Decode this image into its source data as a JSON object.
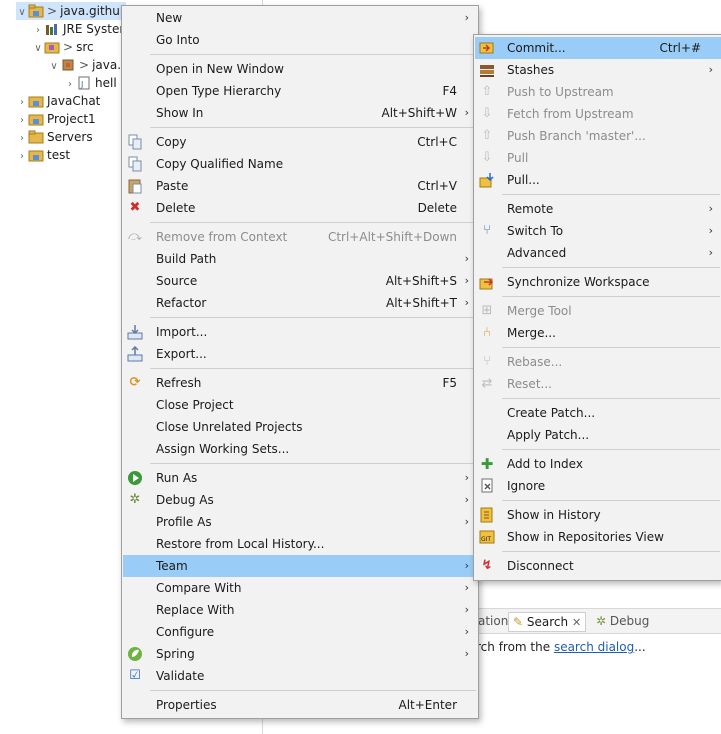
{
  "explorer": {
    "rows": [
      {
        "label": "java.githubr",
        "prefix": ">",
        "twist": "∨"
      },
      {
        "label": "JRE System",
        "twist": "›"
      },
      {
        "label": "src",
        "prefix": ">",
        "twist": "∨"
      },
      {
        "label": "java.",
        "prefix": ">",
        "twist": "∨"
      },
      {
        "label": "hell",
        "twist": "›"
      },
      {
        "label": "JavaChat",
        "twist": "›"
      },
      {
        "label": "Project1",
        "twist": "›"
      },
      {
        "label": "Servers",
        "twist": "›"
      },
      {
        "label": "test",
        "twist": "›"
      }
    ]
  },
  "bottom": {
    "tab_partial": "ation",
    "search_tab": "Search",
    "debug_tab": "Debug",
    "text_prefix": "rch from the ",
    "link": "search dialog",
    "text_suffix": "..."
  },
  "context_menu": {
    "items": [
      {
        "label": "New",
        "submenu": true
      },
      {
        "label": "Go Into"
      },
      {
        "label": "Open in New Window"
      },
      {
        "label": "Open Type Hierarchy",
        "accel": "F4"
      },
      {
        "label": "Show In",
        "accel": "Alt+Shift+W",
        "submenu": true
      },
      {
        "label": "Copy",
        "accel": "Ctrl+C",
        "icon": "copy-icon"
      },
      {
        "label": "Copy Qualified Name",
        "icon": "copy-qualified-icon"
      },
      {
        "label": "Paste",
        "accel": "Ctrl+V",
        "icon": "paste-icon"
      },
      {
        "label": "Delete",
        "accel": "Delete",
        "icon": "delete-icon"
      },
      {
        "label": "Remove from Context",
        "accel": "Ctrl+Alt+Shift+Down",
        "disabled": true,
        "icon": "remove-context-icon"
      },
      {
        "label": "Build Path",
        "submenu": true
      },
      {
        "label": "Source",
        "accel": "Alt+Shift+S",
        "submenu": true
      },
      {
        "label": "Refactor",
        "accel": "Alt+Shift+T",
        "submenu": true
      },
      {
        "label": "Import...",
        "icon": "import-icon"
      },
      {
        "label": "Export...",
        "icon": "export-icon"
      },
      {
        "label": "Refresh",
        "accel": "F5",
        "icon": "refresh-icon"
      },
      {
        "label": "Close Project"
      },
      {
        "label": "Close Unrelated Projects"
      },
      {
        "label": "Assign Working Sets..."
      },
      {
        "label": "Run As",
        "submenu": true,
        "icon": "run-icon"
      },
      {
        "label": "Debug As",
        "submenu": true,
        "icon": "debug-icon"
      },
      {
        "label": "Profile As",
        "submenu": true
      },
      {
        "label": "Restore from Local History..."
      },
      {
        "label": "Team",
        "submenu": true,
        "highlighted": true
      },
      {
        "label": "Compare With",
        "submenu": true
      },
      {
        "label": "Replace With",
        "submenu": true
      },
      {
        "label": "Configure",
        "submenu": true
      },
      {
        "label": "Spring",
        "submenu": true,
        "icon": "spring-icon"
      },
      {
        "label": "Validate",
        "icon": "checkbox-icon"
      },
      {
        "label": "Properties",
        "accel": "Alt+Enter"
      }
    ]
  },
  "team_menu": {
    "items": [
      {
        "label": "Commit...",
        "accel": "Ctrl+#",
        "highlighted": true,
        "icon": "commit-icon"
      },
      {
        "label": "Stashes",
        "submenu": true,
        "icon": "stash-icon"
      },
      {
        "label": "Push to Upstream",
        "disabled": true,
        "icon": "push-icon"
      },
      {
        "label": "Fetch from Upstream",
        "disabled": true,
        "icon": "fetch-icon"
      },
      {
        "label": "Push Branch 'master'...",
        "disabled": true,
        "icon": "push-branch-icon"
      },
      {
        "label": "Pull",
        "disabled": true,
        "icon": "pull-icon"
      },
      {
        "label": "Pull...",
        "icon": "pull-dialog-icon"
      },
      {
        "label": "Remote",
        "submenu": true
      },
      {
        "label": "Switch To",
        "submenu": true,
        "icon": "switch-branch-icon"
      },
      {
        "label": "Advanced",
        "submenu": true
      },
      {
        "label": "Synchronize Workspace",
        "icon": "synchronize-icon"
      },
      {
        "label": "Merge Tool",
        "disabled": true,
        "icon": "merge-tool-icon"
      },
      {
        "label": "Merge...",
        "icon": "merge-icon"
      },
      {
        "label": "Rebase...",
        "disabled": true,
        "icon": "rebase-icon"
      },
      {
        "label": "Reset...",
        "disabled": true,
        "icon": "reset-icon"
      },
      {
        "label": "Create Patch..."
      },
      {
        "label": "Apply Patch..."
      },
      {
        "label": "Add to Index",
        "icon": "add-index-icon"
      },
      {
        "label": "Ignore",
        "icon": "ignore-icon"
      },
      {
        "label": "Show in History",
        "icon": "history-icon"
      },
      {
        "label": "Show in Repositories View",
        "icon": "repositories-icon"
      },
      {
        "label": "Disconnect",
        "icon": "disconnect-icon"
      }
    ]
  }
}
